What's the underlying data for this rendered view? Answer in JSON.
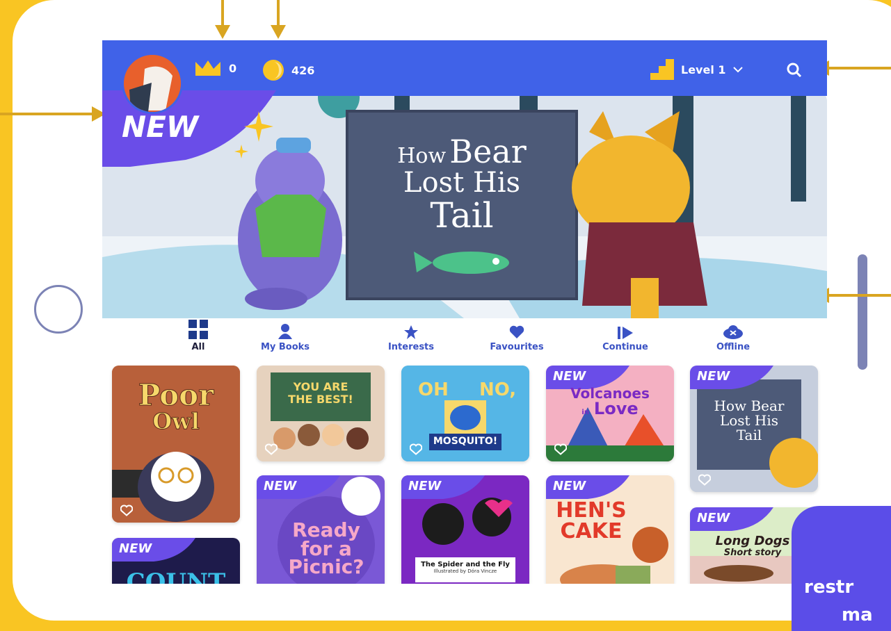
{
  "header": {
    "crowns": "0",
    "coins": "426",
    "level": "Level 1"
  },
  "hero": {
    "badge": "NEW",
    "title_line1_small": "How",
    "title_line1_big": "Bear",
    "title_line2": "Lost His",
    "title_line3": "Tail",
    "slides": 5,
    "active_slide": 4
  },
  "tabs": [
    {
      "label": "All",
      "icon": "grid-icon"
    },
    {
      "label": "My Books",
      "icon": "person-icon"
    },
    {
      "label": "Interests",
      "icon": "star-icon"
    },
    {
      "label": "Favourites",
      "icon": "heart-icon"
    },
    {
      "label": "Continue",
      "icon": "resume-icon"
    },
    {
      "label": "Offline",
      "icon": "cloud-offline-icon"
    }
  ],
  "books": {
    "poor_owl": {
      "l1": "Poor",
      "l2": "Owl"
    },
    "best": {
      "l1": "YOU ARE",
      "l2": "THE BEST!"
    },
    "mosquito": {
      "l1": "OH",
      "l2": "NO,",
      "l3": "MOSQUITO!"
    },
    "volcanoes": {
      "badge": "NEW",
      "l1": "Volcanoes",
      "l2": "in",
      "l3": "Love"
    },
    "bear": {
      "badge": "NEW",
      "l1": "How Bear",
      "l2": "Lost His",
      "l3": "Tail"
    },
    "picnic": {
      "badge": "NEW",
      "l1": "Ready",
      "l2": "for a",
      "l3": "Picnic?"
    },
    "spider": {
      "badge": "NEW",
      "title": "The Spider and the Fly",
      "subtitle": "Illustrated by Dóra Vincze"
    },
    "hens": {
      "badge": "NEW",
      "l1": "HEN'S",
      "l2": "CAKE"
    },
    "count": {
      "badge": "NEW",
      "l1": "COUNT"
    },
    "longdogs": {
      "badge": "NEW",
      "l1": "Long Dogs",
      "l2": "Short story"
    }
  },
  "promo": {
    "line1": "restr",
    "line2": "ma"
  },
  "colors": {
    "brand": "#4062E8",
    "frame": "#F9C523",
    "annotation": "#D9A521"
  }
}
